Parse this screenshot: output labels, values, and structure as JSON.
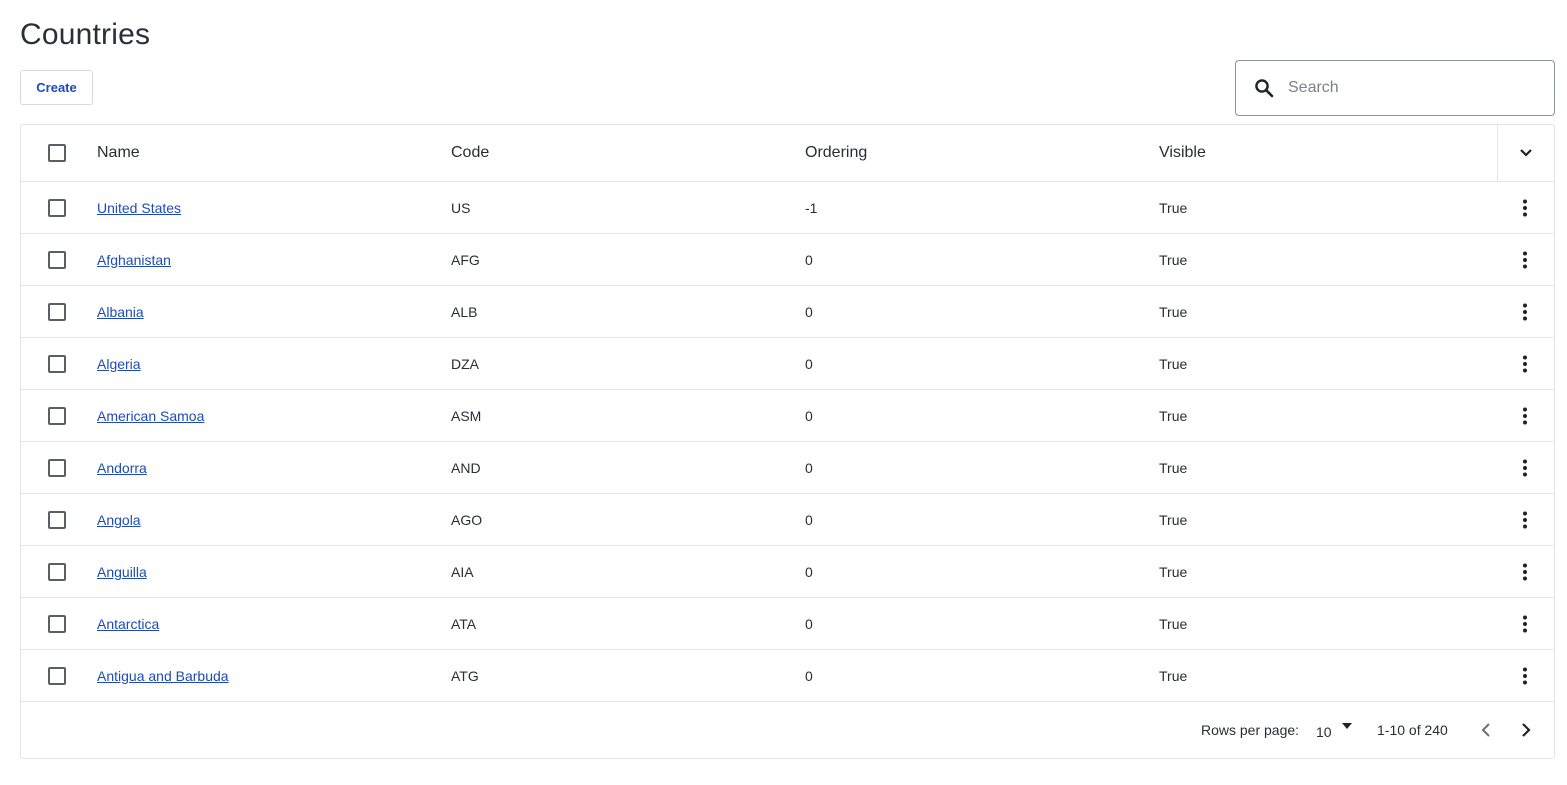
{
  "page": {
    "title": "Countries"
  },
  "toolbar": {
    "create_label": "Create"
  },
  "search": {
    "placeholder": "Search",
    "value": ""
  },
  "table": {
    "columns": [
      "Name",
      "Code",
      "Ordering",
      "Visible"
    ],
    "rows": [
      {
        "name": "United States",
        "code": "US",
        "ordering": "-1",
        "visible": "True"
      },
      {
        "name": "Afghanistan",
        "code": "AFG",
        "ordering": "0",
        "visible": "True"
      },
      {
        "name": "Albania",
        "code": "ALB",
        "ordering": "0",
        "visible": "True"
      },
      {
        "name": "Algeria",
        "code": "DZA",
        "ordering": "0",
        "visible": "True"
      },
      {
        "name": "American Samoa",
        "code": "ASM",
        "ordering": "0",
        "visible": "True"
      },
      {
        "name": "Andorra",
        "code": "AND",
        "ordering": "0",
        "visible": "True"
      },
      {
        "name": "Angola",
        "code": "AGO",
        "ordering": "0",
        "visible": "True"
      },
      {
        "name": "Anguilla",
        "code": "AIA",
        "ordering": "0",
        "visible": "True"
      },
      {
        "name": "Antarctica",
        "code": "ATA",
        "ordering": "0",
        "visible": "True"
      },
      {
        "name": "Antigua and Barbuda",
        "code": "ATG",
        "ordering": "0",
        "visible": "True"
      }
    ]
  },
  "pagination": {
    "rows_per_page_label": "Rows per page:",
    "rows_per_page": "10",
    "range": "1-10 of 240"
  },
  "icons": {
    "search": "search-icon",
    "column_toggle": "chevron-down-icon",
    "row_menu": "more-vertical-icon",
    "select_arrow": "caret-down-icon",
    "prev": "chevron-left-icon",
    "next": "chevron-right-icon"
  },
  "colors": {
    "link": "#1e4bb8",
    "border": "#e2e4e8"
  }
}
